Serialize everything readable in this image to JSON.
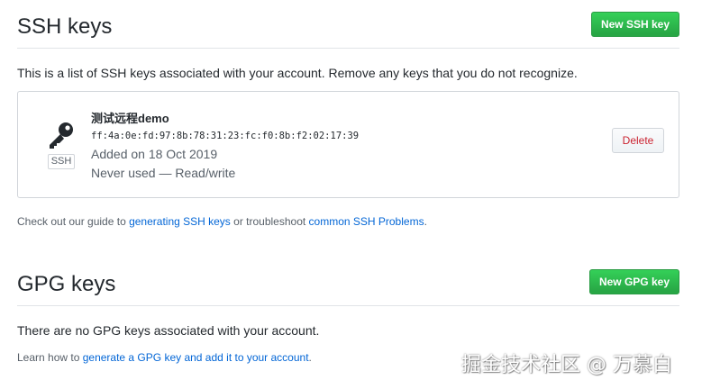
{
  "ssh": {
    "title": "SSH keys",
    "new_button_label": "New SSH key",
    "description": "This is a list of SSH keys associated with your account. Remove any keys that you do not recognize.",
    "key": {
      "title": "测试远程demo",
      "fingerprint": "ff:4a:0e:fd:97:8b:78:31:23:fc:f0:8b:f2:02:17:39",
      "added": "Added on 18 Oct 2019",
      "usage": "Never used — Read/write",
      "badge": "SSH",
      "delete_label": "Delete",
      "icon": "key-icon"
    },
    "guide": {
      "prefix": "Check out our guide to ",
      "link1": "generating SSH keys",
      "middle": " or troubleshoot ",
      "link2": "common SSH Problems",
      "suffix": "."
    }
  },
  "gpg": {
    "title": "GPG keys",
    "new_button_label": "New GPG key",
    "empty_text": "There are no GPG keys associated with your account.",
    "learn": {
      "prefix": "Learn how to ",
      "link": "generate a GPG key and add it to your account",
      "suffix": "."
    }
  },
  "watermark": "掘金技术社区 @ 万慕白",
  "colors": {
    "green": "#2ea44f",
    "link": "#0366d6",
    "danger": "#cb2431",
    "border": "#e1e4e8"
  }
}
